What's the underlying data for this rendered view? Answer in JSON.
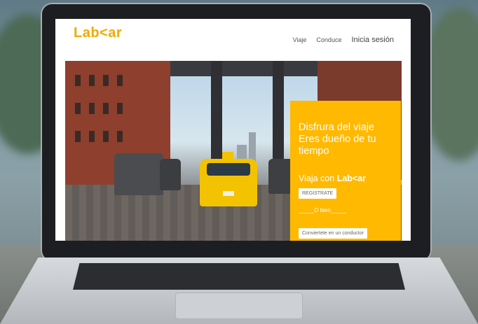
{
  "site": {
    "logo": "Lab<ar",
    "nav": {
      "trip": "Viaje",
      "driver": "Conduce",
      "login": "Inicia sesión"
    }
  },
  "hero": {
    "tagline": "Disfrura del viaje Eres dueño de tu tiempo",
    "travel_prefix": "Viaja con",
    "travel_brand": "Lab<ar",
    "register_button": "REGISTRATE",
    "or_text": "_____O bien_____",
    "driver_button": "Conviertete en un conductor"
  },
  "colors": {
    "brand": "#f2a900",
    "panel": "#ffb900"
  }
}
